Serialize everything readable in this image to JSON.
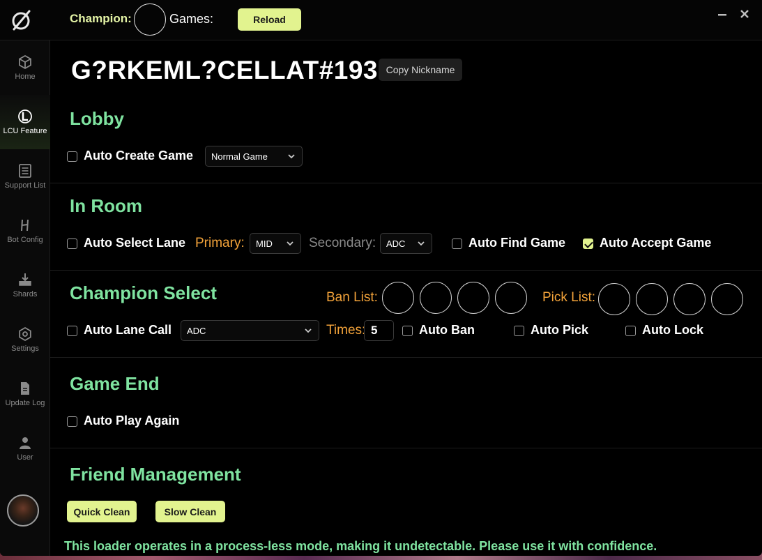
{
  "header": {
    "champion_label": "Champion:",
    "games_label": "Games:",
    "reload_label": "Reload"
  },
  "sidebar": {
    "items": [
      {
        "label": "Home",
        "icon": "cube-icon"
      },
      {
        "label": "LCU Feature",
        "icon": "league-logo-icon",
        "active": true
      },
      {
        "label": "Support List",
        "icon": "list-icon"
      },
      {
        "label": "Bot Config",
        "icon": "bot-icon"
      },
      {
        "label": "Shards",
        "icon": "shards-icon"
      },
      {
        "label": "Settings",
        "icon": "settings-icon"
      },
      {
        "label": "Update Log",
        "icon": "document-icon"
      },
      {
        "label": "User",
        "icon": "user-icon"
      }
    ]
  },
  "account": {
    "nickname": "G?RKEML?CELLAT#1938",
    "copy_label": "Copy Nickname"
  },
  "lobby": {
    "title": "Lobby",
    "auto_create_label": "Auto Create Game",
    "auto_create_checked": false,
    "game_type": "Normal Game"
  },
  "in_room": {
    "title": "In Room",
    "auto_select_label": "Auto Select Lane",
    "auto_select_checked": false,
    "primary_label": "Primary:",
    "primary_value": "MID",
    "secondary_label": "Secondary:",
    "secondary_value": "ADC",
    "auto_find_label": "Auto Find Game",
    "auto_find_checked": false,
    "auto_accept_label": "Auto Accept Game",
    "auto_accept_checked": true
  },
  "champ_select": {
    "title": "Champion Select",
    "ban_list_label": "Ban List:",
    "pick_list_label": "Pick List:",
    "auto_lane_call_label": "Auto Lane Call",
    "auto_lane_call_checked": false,
    "lane_call_value": "ADC",
    "times_label": "Times:",
    "times_value": "5",
    "auto_ban_label": "Auto Ban",
    "auto_ban_checked": false,
    "auto_pick_label": "Auto Pick",
    "auto_pick_checked": false,
    "auto_lock_label": "Auto Lock",
    "auto_lock_checked": false
  },
  "game_end": {
    "title": "Game End",
    "auto_play_again_label": "Auto Play Again",
    "auto_play_again_checked": false
  },
  "friends": {
    "title": "Friend Management",
    "quick_clean_label": "Quick Clean",
    "slow_clean_label": "Slow Clean"
  },
  "footer": {
    "message": "This loader operates in a process-less mode, making it undetectable. Please use it with confidence."
  },
  "colors": {
    "accent": "#e2f38f",
    "section_title": "#7fe3a0",
    "orange_label": "#f3a33a"
  }
}
